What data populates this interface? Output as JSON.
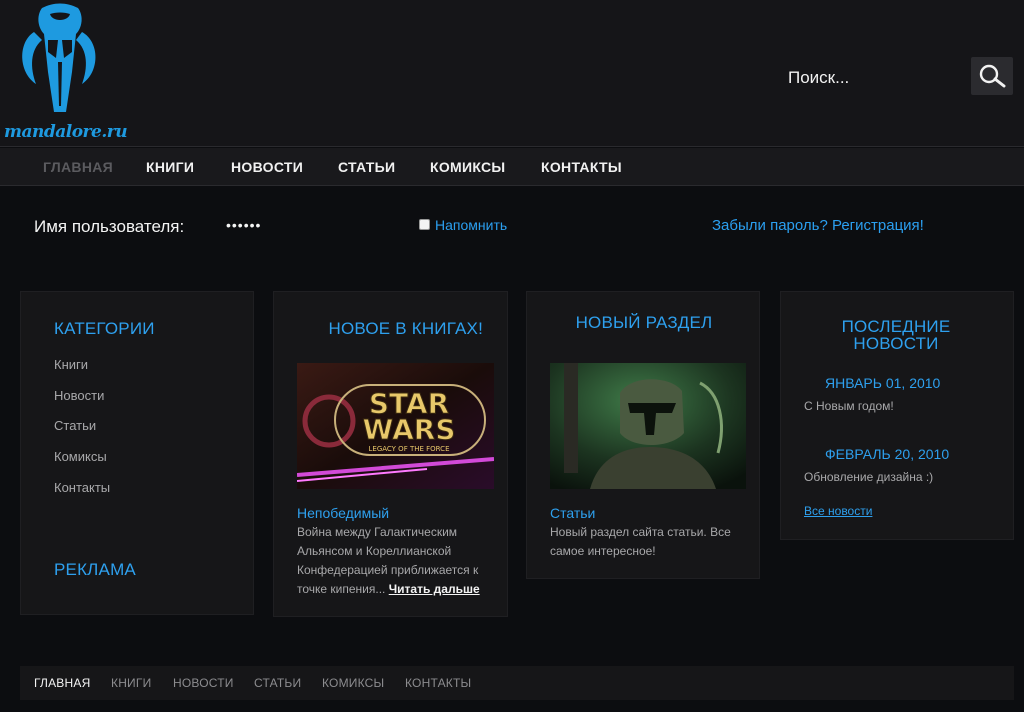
{
  "header": {
    "logo_text": "mandalore.ru",
    "search_placeholder": "Поиск...",
    "search_icon": "magnifier-icon"
  },
  "nav": {
    "items": [
      "ГЛАВНАЯ",
      "КНИГИ",
      "НОВОСТИ",
      "СТАТЬИ",
      "КОМИКСЫ",
      "КОНТАКТЫ"
    ],
    "active_index": 0
  },
  "login": {
    "username_label": "Имя пользователя:",
    "password_value": "••••••",
    "remember_label": "Напомнить",
    "forgot_link": "Забыли пароль? Регистрация!"
  },
  "categories": {
    "title": "КАТЕГОРИИ",
    "items": [
      "Книги",
      "Новости",
      "Статьи",
      "Комиксы",
      "Контакты"
    ],
    "ads_title": "РЕКЛАМА"
  },
  "books": {
    "title": "НОВОЕ В КНИГАХ!",
    "item_title": "Непобедимый",
    "item_text": "Война между Галактическим Альянсом и Кореллианской Конфедерацией приближается к точке кипения...",
    "read_more": "Читать дальше"
  },
  "new_section": {
    "title": "НОВЫЙ РАЗДЕЛ",
    "item_title": "Статьи",
    "item_text": "Новый раздел сайта статьи. Все самое интересное!"
  },
  "news": {
    "title": "ПОСЛЕДНИЕ НОВОСТИ",
    "items": [
      {
        "date": "ЯНВАРЬ 01, 2010",
        "text": "С Новым годом!"
      },
      {
        "date": "ФЕВРАЛЬ 20, 2010",
        "text": "Обновление дизайна :)"
      }
    ],
    "all_news": "Все новости"
  },
  "footer": {
    "items": [
      "ГЛАВНАЯ",
      "КНИГИ",
      "НОВОСТИ",
      "СТАТЬИ",
      "КОМИКСЫ",
      "КОНТАКТЫ"
    ],
    "active_index": 0
  },
  "colors": {
    "accent": "#2ea0ee",
    "background": "#0c0d10",
    "panel": "#161618"
  }
}
